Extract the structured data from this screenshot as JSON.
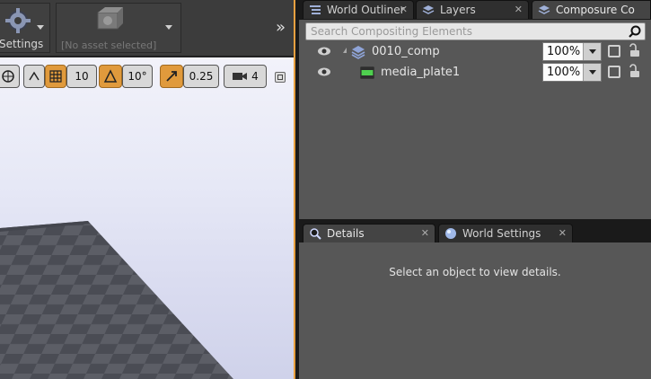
{
  "toolbar": {
    "settings_label": "Settings",
    "asset_label": "[No asset selected]",
    "expand_label": "»"
  },
  "viewport_toolbar": {
    "grid_snap_value": "10",
    "rotation_snap_value": "10°",
    "scale_snap_value": "0.25",
    "camera_speed_value": "4"
  },
  "top_tabs": [
    {
      "label": "World Outliner"
    },
    {
      "label": "Layers"
    },
    {
      "label": "Composure Co"
    }
  ],
  "outliner": {
    "search_placeholder": "Search Compositing Elements",
    "rows": [
      {
        "label": "0010_comp",
        "opacity": "100%"
      },
      {
        "label": "media_plate1",
        "opacity": "100%"
      }
    ]
  },
  "bottom_tabs": [
    {
      "label": "Details"
    },
    {
      "label": "World Settings"
    }
  ],
  "details": {
    "empty_message": "Select an object to view details."
  },
  "colors": {
    "accent_orange": "#e09a3c",
    "panel_bg": "#575757",
    "tab_active": "#444444"
  }
}
